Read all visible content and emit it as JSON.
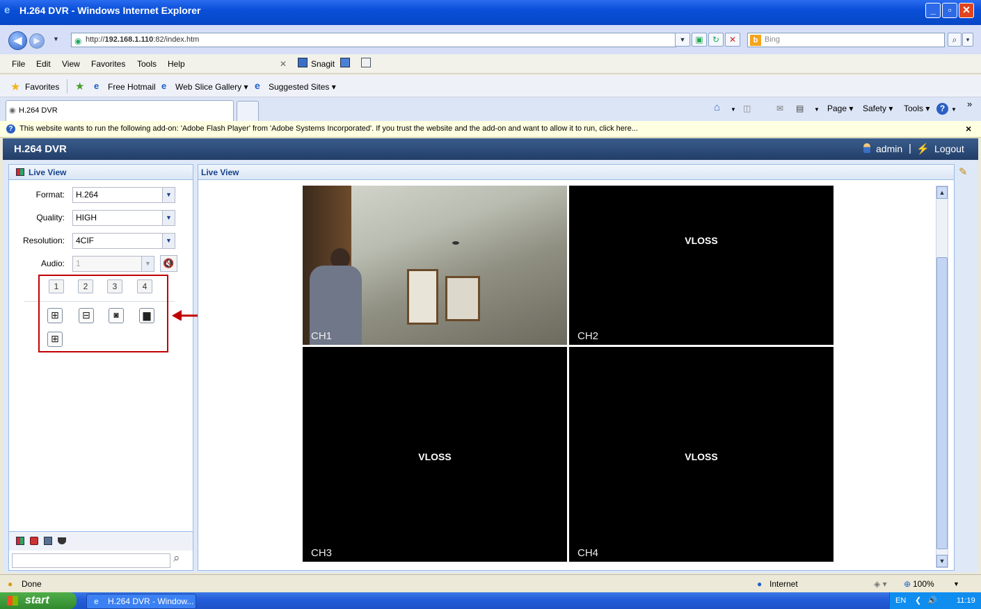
{
  "window": {
    "title": "H.264 DVR - Windows Internet Explorer"
  },
  "address": {
    "url_prefix": "http://",
    "url_host": "192.168.1.110",
    "url_rest": ":82/index.htm",
    "search_placeholder": "Bing"
  },
  "menu": [
    "File",
    "Edit",
    "View",
    "Favorites",
    "Tools",
    "Help"
  ],
  "snagit_label": "Snagit",
  "favorites": {
    "label": "Favorites",
    "items": [
      "Free Hotmail",
      "Web Slice Gallery ▾",
      "Suggested Sites ▾"
    ]
  },
  "tab": {
    "label": "H.264 DVR"
  },
  "commands": {
    "page": "Page ▾",
    "safety": "Safety ▾",
    "tools": "Tools ▾"
  },
  "infobar": {
    "text": "This website wants to run the following add-on: 'Adobe Flash Player' from 'Adobe Systems Incorporated'. If you trust the website and the add-on and want to allow it to run, click here...",
    "close": "×"
  },
  "app": {
    "title": "H.264 DVR",
    "user": "admin",
    "separator": "|",
    "logout": "Logout"
  },
  "left_panel": {
    "title": "Live View",
    "fields": [
      {
        "label": "Format:",
        "value": "H.264"
      },
      {
        "label": "Quality:",
        "value": "HIGH"
      },
      {
        "label": "Resolution:",
        "value": "4CIF"
      },
      {
        "label": "Audio:",
        "value": "1"
      }
    ],
    "channel_buttons": [
      "1",
      "2",
      "3",
      "4"
    ],
    "annotation": "1"
  },
  "right_panel": {
    "title": "Live View",
    "channels": [
      {
        "label": "CH1",
        "status": ""
      },
      {
        "label": "CH2",
        "status": "VLOSS"
      },
      {
        "label": "CH3",
        "status": "VLOSS"
      },
      {
        "label": "CH4",
        "status": "VLOSS"
      }
    ]
  },
  "status": {
    "text": "Done",
    "zone": "Internet",
    "zoom": "100%"
  },
  "taskbar": {
    "start": "start",
    "item": "H.264 DVR - Window...",
    "lang": "EN",
    "time": "11:19"
  },
  "colors": {
    "accent": "#15428b",
    "annotation_red": "#c00000",
    "header": "#2c4a78"
  }
}
